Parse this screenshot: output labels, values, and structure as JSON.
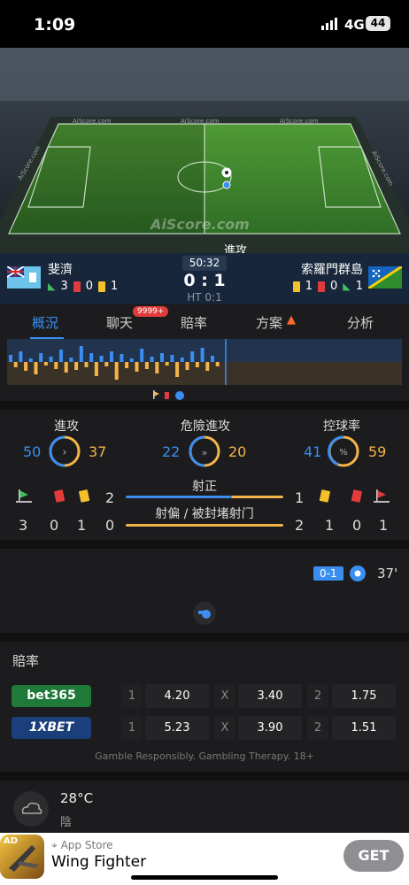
{
  "status_bar": {
    "time": "1:09",
    "network": "4G",
    "battery": "44"
  },
  "pitch": {
    "brand_texts": [
      "AiScore.com",
      "AiScore.com",
      "AiScore.com",
      "AiScore.com",
      "AiScore.com"
    ],
    "watermark": "AiScore.com",
    "event_label": "進攻",
    "event_team": "斐濟"
  },
  "match": {
    "home": {
      "name": "斐濟",
      "corners": "3",
      "reds": "0",
      "yellows": "1"
    },
    "away": {
      "name": "索羅門群島",
      "yellows": "1",
      "reds": "0",
      "corners": "1"
    },
    "clock": "50:32",
    "score": "0 : 1",
    "half_time": "HT 0:1"
  },
  "tabs": [
    {
      "label": "概況",
      "active": true
    },
    {
      "label": "聊天",
      "active": false,
      "badge": "9999+"
    },
    {
      "label": "賠率",
      "active": false
    },
    {
      "label": "方案",
      "active": false,
      "icon": "flame-icon"
    },
    {
      "label": "分析",
      "active": false
    }
  ],
  "stats": {
    "attacks": {
      "label": "進攻",
      "home": "50",
      "away": "37"
    },
    "dangerous": {
      "label": "危險進攻",
      "home": "22",
      "away": "20"
    },
    "possession": {
      "label": "控球率",
      "home": "41",
      "away": "59"
    },
    "on_target": {
      "label": "射正",
      "home": "2",
      "away": "1"
    },
    "off_target": {
      "label": "射偏 / 被封堵射门",
      "home": "0",
      "away": "2"
    },
    "home_corners": "3",
    "home_reds": "0",
    "home_yellows": "1",
    "away_yellows": "1",
    "away_reds": "0",
    "away_corners": "1"
  },
  "events": {
    "score": "0-1",
    "minute": "37'"
  },
  "odds": {
    "title": "賠率",
    "rows": [
      {
        "book": "bet365",
        "l1": "1",
        "v1": "4.20",
        "lx": "X",
        "vx": "3.40",
        "l2": "2",
        "v2": "1.75"
      },
      {
        "book": "1XBET",
        "l1": "1",
        "v1": "5.23",
        "lx": "X",
        "vx": "3.90",
        "l2": "2",
        "v2": "1.51"
      }
    ],
    "disclaimer": "Gamble Responsibly. Gambling Therapy. 18+"
  },
  "weather": {
    "temp": "28°C",
    "desc": "陰"
  },
  "ad": {
    "tag": "AD",
    "store": "App Store",
    "title": "Wing Fighter",
    "cta": "GET"
  },
  "colors": {
    "accent": "#3b8ef0",
    "away": "#f3b44a",
    "bg": "#1c1c1e"
  }
}
